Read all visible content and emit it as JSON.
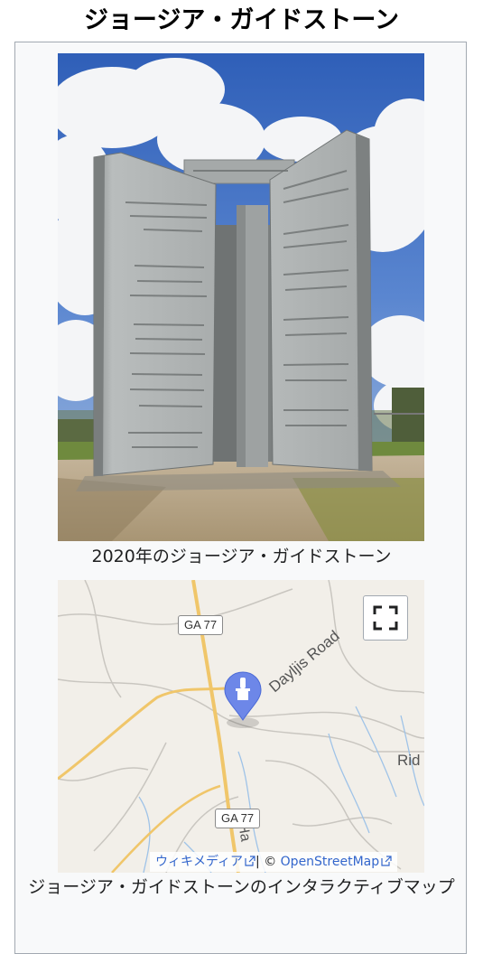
{
  "page": {
    "title": "ジョージア・ガイドストーン"
  },
  "image": {
    "caption": "2020年のジョージア・ガイドストーン"
  },
  "map": {
    "caption": "ジョージア・ガイドストーンのインタラクティブマップ",
    "labels": {
      "road1": "GA 77",
      "road2": "GA 77",
      "street": "Dayljis Road",
      "ridge": "Rid",
      "vertical": "Ha"
    },
    "attribution": {
      "wikimedia": "ウィキメディア",
      "separator": "| ©",
      "osm": "OpenStreetMap"
    }
  },
  "icons": {
    "fullscreen": "fullscreen-icon",
    "marker": "map-pin-icon",
    "external": "external-link-icon"
  }
}
